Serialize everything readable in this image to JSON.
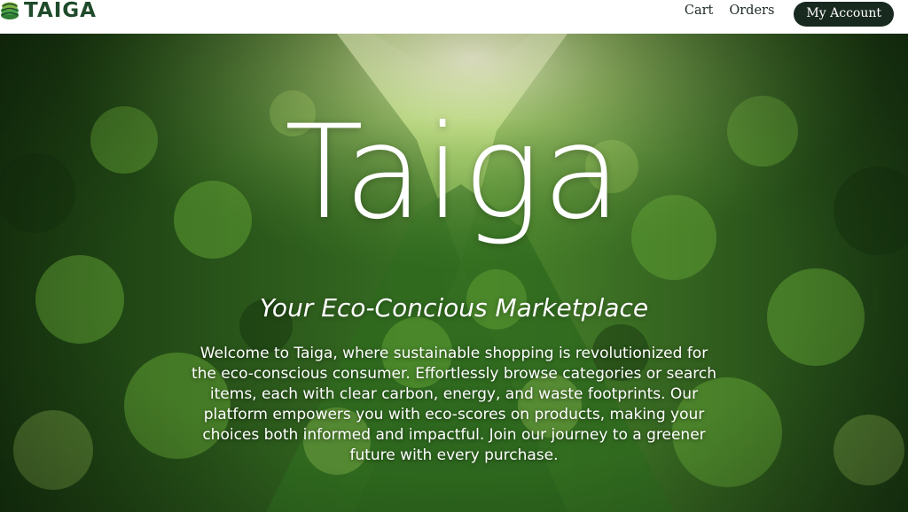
{
  "brand": {
    "name": "TAIGA",
    "logo_icon": "leaf-stack-icon"
  },
  "nav": {
    "cart_label": "Cart",
    "orders_label": "Orders",
    "account_label": "My Account"
  },
  "hero": {
    "title": "Taiga",
    "subtitle": "Your Eco-Concious Marketplace",
    "description": "Welcome to Taiga, where sustainable shopping is revolutionized for the eco-conscious consumer. Effortlessly browse categories or search items, each with clear carbon, energy, and waste footprints. Our platform empowers you with eco-scores on products, making your choices both informed and impactful. Join our journey to a greener future with every purchase."
  },
  "colors": {
    "brand_dark": "#1f4a2b",
    "button_bg": "#18291f",
    "hero_text": "#ffffff"
  }
}
